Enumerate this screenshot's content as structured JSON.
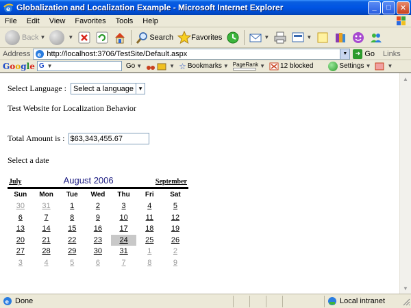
{
  "window": {
    "title": "Globalization and Localization Example - Microsoft Internet Explorer"
  },
  "menu": [
    "File",
    "Edit",
    "View",
    "Favorites",
    "Tools",
    "Help"
  ],
  "toolbar": {
    "back_label": "Back",
    "search_label": "Search",
    "favorites_label": "Favorites"
  },
  "address": {
    "label": "Address",
    "url": "http://localhost:3706/TestSite/Default.aspx",
    "go_label": "Go",
    "links_label": "Links"
  },
  "googlebar": {
    "go_label": "Go",
    "bookmarks_label": "Bookmarks",
    "pagerank_label": "PageRank",
    "blocked_label": "12 blocked",
    "settings_label": "Settings"
  },
  "page": {
    "select_language_label": "Select Language :",
    "language_select_value": "Select a language",
    "heading": "Test Website for Localization Behavior",
    "total_amount_label": "Total Amount is :",
    "total_amount_value": "$63,343,455.67",
    "select_date_label": "Select a date"
  },
  "calendar": {
    "prev_label": "July",
    "month_title": "August 2006",
    "next_label": "September",
    "days_of_week": [
      "Sun",
      "Mon",
      "Tue",
      "Wed",
      "Thu",
      "Fri",
      "Sat"
    ],
    "weeks": [
      [
        {
          "d": "30",
          "o": true
        },
        {
          "d": "31",
          "o": true
        },
        {
          "d": "1"
        },
        {
          "d": "2"
        },
        {
          "d": "3"
        },
        {
          "d": "4"
        },
        {
          "d": "5"
        }
      ],
      [
        {
          "d": "6"
        },
        {
          "d": "7"
        },
        {
          "d": "8"
        },
        {
          "d": "9"
        },
        {
          "d": "10"
        },
        {
          "d": "11"
        },
        {
          "d": "12"
        }
      ],
      [
        {
          "d": "13"
        },
        {
          "d": "14"
        },
        {
          "d": "15"
        },
        {
          "d": "16"
        },
        {
          "d": "17"
        },
        {
          "d": "18"
        },
        {
          "d": "19"
        }
      ],
      [
        {
          "d": "20"
        },
        {
          "d": "21"
        },
        {
          "d": "22"
        },
        {
          "d": "23"
        },
        {
          "d": "24",
          "t": true
        },
        {
          "d": "25"
        },
        {
          "d": "26"
        }
      ],
      [
        {
          "d": "27"
        },
        {
          "d": "28"
        },
        {
          "d": "29"
        },
        {
          "d": "30"
        },
        {
          "d": "31"
        },
        {
          "d": "1",
          "o": true
        },
        {
          "d": "2",
          "o": true
        }
      ],
      [
        {
          "d": "3",
          "o": true
        },
        {
          "d": "4",
          "o": true
        },
        {
          "d": "5",
          "o": true
        },
        {
          "d": "6",
          "o": true
        },
        {
          "d": "7",
          "o": true
        },
        {
          "d": "8",
          "o": true
        },
        {
          "d": "9",
          "o": true
        }
      ]
    ]
  },
  "status": {
    "text": "Done",
    "zone": "Local intranet"
  },
  "colors": {
    "titlebar": "#0054e3",
    "chrome": "#ece9d8",
    "today_highlight": "#c8c8c8",
    "month_title": "#1a1a80"
  }
}
